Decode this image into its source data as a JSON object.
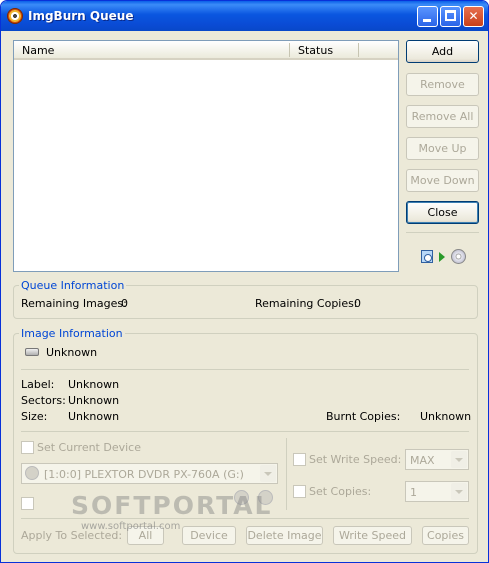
{
  "window": {
    "title": "ImgBurn Queue"
  },
  "list": {
    "columns": [
      "Name",
      "Status"
    ],
    "rows": []
  },
  "buttons": {
    "add": "Add",
    "remove": "Remove",
    "remove_all": "Remove All",
    "move_up": "Move Up",
    "move_down": "Move Down",
    "close": "Close"
  },
  "queue_info": {
    "title": "Queue Information",
    "remaining_images_label": "Remaining Images:",
    "remaining_images": "0",
    "remaining_copies_label": "Remaining Copies:",
    "remaining_copies": "0"
  },
  "image_info": {
    "title": "Image Information",
    "source": "Unknown",
    "label_label": "Label:",
    "label": "Unknown",
    "sectors_label": "Sectors:",
    "sectors": "Unknown",
    "size_label": "Size:",
    "size": "Unknown",
    "burnt_copies_label": "Burnt Copies:",
    "burnt_copies": "Unknown",
    "set_current_device": "Set Current Device",
    "device": "[1:0:0] PLEXTOR DVDR   PX-760A (G:)",
    "set_write_speed": "Set Write Speed:",
    "write_speed": "MAX",
    "set_copies": "Set Copies:",
    "copies": "1",
    "apply_label": "Apply To Selected:",
    "apply_buttons": [
      "All",
      "Device",
      "Delete Image",
      "Write Speed",
      "Copies"
    ]
  },
  "watermark": {
    "big": "SOFTPORTAL",
    "small": "www.softportal.com"
  },
  "colors": {
    "title_bar": "#0a56e0",
    "group_label": "#0046d5",
    "face": "#ece9d8"
  }
}
